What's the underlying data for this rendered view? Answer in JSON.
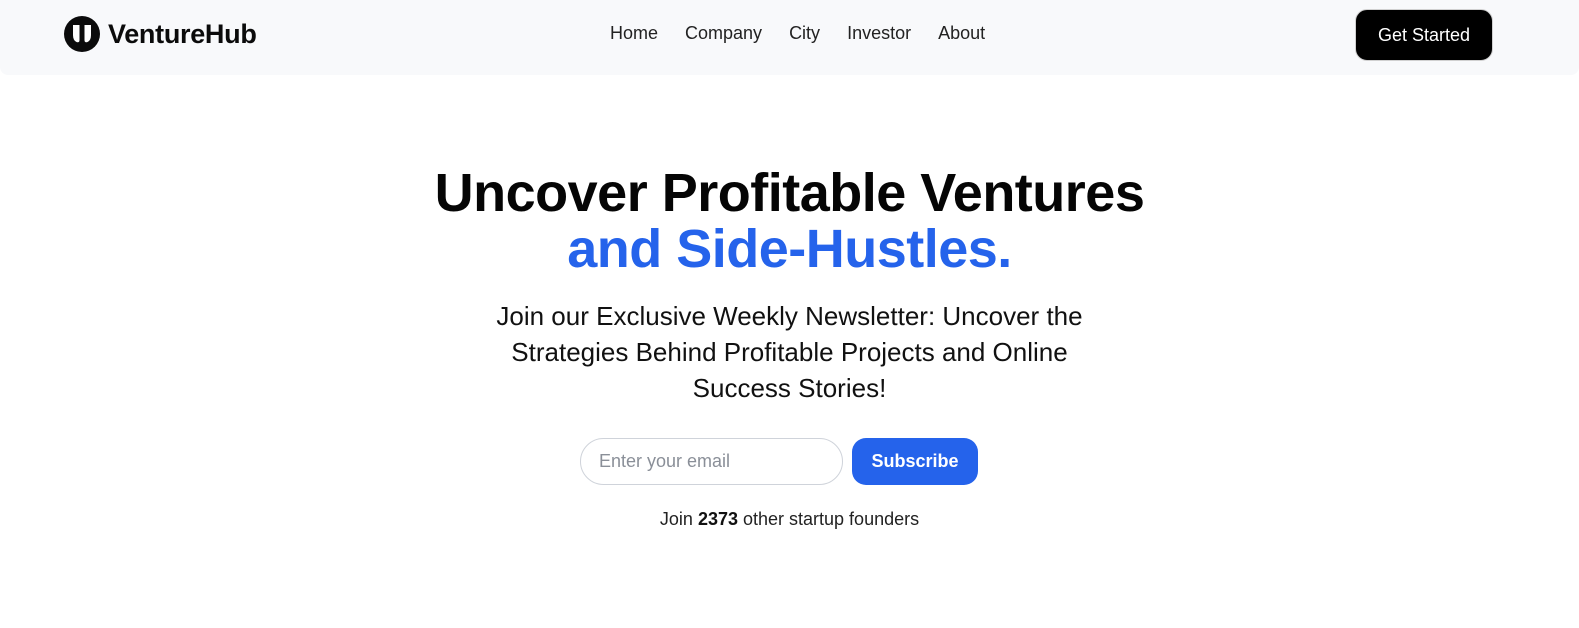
{
  "brand": {
    "name": "VentureHub",
    "icon": "venturehub-logo-icon"
  },
  "nav": {
    "links": [
      {
        "label": "Home"
      },
      {
        "label": "Company"
      },
      {
        "label": "City"
      },
      {
        "label": "Investor"
      },
      {
        "label": "About"
      }
    ],
    "cta_label": "Get Started"
  },
  "hero": {
    "headline_line1": "Uncover Profitable Ventures",
    "headline_line2": "and Side-Hustles.",
    "subheadline": "Join our Exclusive Weekly Newsletter: Uncover the Strategies Behind Profitable Projects and Online Success Stories!"
  },
  "signup": {
    "email_placeholder": "Enter your email",
    "email_value": "",
    "button_label": "Subscribe"
  },
  "social_proof": {
    "prefix": "Join",
    "count": "2373",
    "suffix": "other startup founders"
  },
  "colors": {
    "accent": "#2563eb",
    "nav_background": "#f8f9fb",
    "cta_background": "#000000"
  }
}
